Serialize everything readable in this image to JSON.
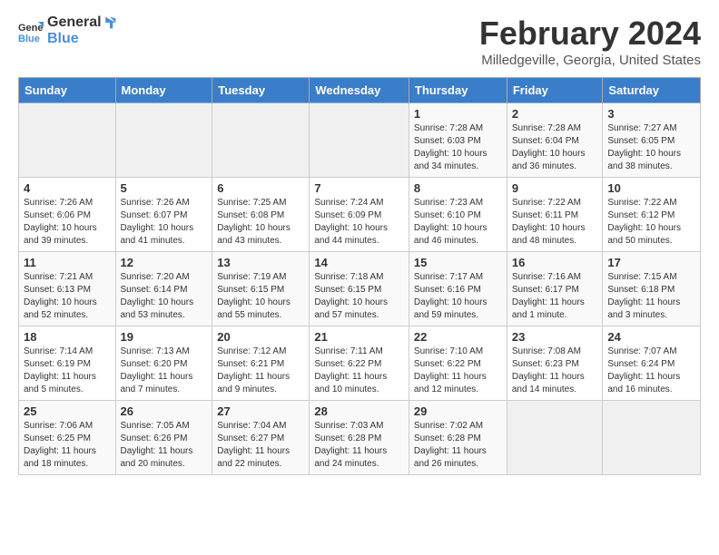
{
  "logo": {
    "general": "General",
    "blue": "Blue"
  },
  "title": "February 2024",
  "subtitle": "Milledgeville, Georgia, United States",
  "days_header": [
    "Sunday",
    "Monday",
    "Tuesday",
    "Wednesday",
    "Thursday",
    "Friday",
    "Saturday"
  ],
  "weeks": [
    [
      {
        "day": "",
        "info": ""
      },
      {
        "day": "",
        "info": ""
      },
      {
        "day": "",
        "info": ""
      },
      {
        "day": "",
        "info": ""
      },
      {
        "day": "1",
        "info": "Sunrise: 7:28 AM\nSunset: 6:03 PM\nDaylight: 10 hours\nand 34 minutes."
      },
      {
        "day": "2",
        "info": "Sunrise: 7:28 AM\nSunset: 6:04 PM\nDaylight: 10 hours\nand 36 minutes."
      },
      {
        "day": "3",
        "info": "Sunrise: 7:27 AM\nSunset: 6:05 PM\nDaylight: 10 hours\nand 38 minutes."
      }
    ],
    [
      {
        "day": "4",
        "info": "Sunrise: 7:26 AM\nSunset: 6:06 PM\nDaylight: 10 hours\nand 39 minutes."
      },
      {
        "day": "5",
        "info": "Sunrise: 7:26 AM\nSunset: 6:07 PM\nDaylight: 10 hours\nand 41 minutes."
      },
      {
        "day": "6",
        "info": "Sunrise: 7:25 AM\nSunset: 6:08 PM\nDaylight: 10 hours\nand 43 minutes."
      },
      {
        "day": "7",
        "info": "Sunrise: 7:24 AM\nSunset: 6:09 PM\nDaylight: 10 hours\nand 44 minutes."
      },
      {
        "day": "8",
        "info": "Sunrise: 7:23 AM\nSunset: 6:10 PM\nDaylight: 10 hours\nand 46 minutes."
      },
      {
        "day": "9",
        "info": "Sunrise: 7:22 AM\nSunset: 6:11 PM\nDaylight: 10 hours\nand 48 minutes."
      },
      {
        "day": "10",
        "info": "Sunrise: 7:22 AM\nSunset: 6:12 PM\nDaylight: 10 hours\nand 50 minutes."
      }
    ],
    [
      {
        "day": "11",
        "info": "Sunrise: 7:21 AM\nSunset: 6:13 PM\nDaylight: 10 hours\nand 52 minutes."
      },
      {
        "day": "12",
        "info": "Sunrise: 7:20 AM\nSunset: 6:14 PM\nDaylight: 10 hours\nand 53 minutes."
      },
      {
        "day": "13",
        "info": "Sunrise: 7:19 AM\nSunset: 6:15 PM\nDaylight: 10 hours\nand 55 minutes."
      },
      {
        "day": "14",
        "info": "Sunrise: 7:18 AM\nSunset: 6:15 PM\nDaylight: 10 hours\nand 57 minutes."
      },
      {
        "day": "15",
        "info": "Sunrise: 7:17 AM\nSunset: 6:16 PM\nDaylight: 10 hours\nand 59 minutes."
      },
      {
        "day": "16",
        "info": "Sunrise: 7:16 AM\nSunset: 6:17 PM\nDaylight: 11 hours\nand 1 minute."
      },
      {
        "day": "17",
        "info": "Sunrise: 7:15 AM\nSunset: 6:18 PM\nDaylight: 11 hours\nand 3 minutes."
      }
    ],
    [
      {
        "day": "18",
        "info": "Sunrise: 7:14 AM\nSunset: 6:19 PM\nDaylight: 11 hours\nand 5 minutes."
      },
      {
        "day": "19",
        "info": "Sunrise: 7:13 AM\nSunset: 6:20 PM\nDaylight: 11 hours\nand 7 minutes."
      },
      {
        "day": "20",
        "info": "Sunrise: 7:12 AM\nSunset: 6:21 PM\nDaylight: 11 hours\nand 9 minutes."
      },
      {
        "day": "21",
        "info": "Sunrise: 7:11 AM\nSunset: 6:22 PM\nDaylight: 11 hours\nand 10 minutes."
      },
      {
        "day": "22",
        "info": "Sunrise: 7:10 AM\nSunset: 6:22 PM\nDaylight: 11 hours\nand 12 minutes."
      },
      {
        "day": "23",
        "info": "Sunrise: 7:08 AM\nSunset: 6:23 PM\nDaylight: 11 hours\nand 14 minutes."
      },
      {
        "day": "24",
        "info": "Sunrise: 7:07 AM\nSunset: 6:24 PM\nDaylight: 11 hours\nand 16 minutes."
      }
    ],
    [
      {
        "day": "25",
        "info": "Sunrise: 7:06 AM\nSunset: 6:25 PM\nDaylight: 11 hours\nand 18 minutes."
      },
      {
        "day": "26",
        "info": "Sunrise: 7:05 AM\nSunset: 6:26 PM\nDaylight: 11 hours\nand 20 minutes."
      },
      {
        "day": "27",
        "info": "Sunrise: 7:04 AM\nSunset: 6:27 PM\nDaylight: 11 hours\nand 22 minutes."
      },
      {
        "day": "28",
        "info": "Sunrise: 7:03 AM\nSunset: 6:28 PM\nDaylight: 11 hours\nand 24 minutes."
      },
      {
        "day": "29",
        "info": "Sunrise: 7:02 AM\nSunset: 6:28 PM\nDaylight: 11 hours\nand 26 minutes."
      },
      {
        "day": "",
        "info": ""
      },
      {
        "day": "",
        "info": ""
      }
    ]
  ]
}
